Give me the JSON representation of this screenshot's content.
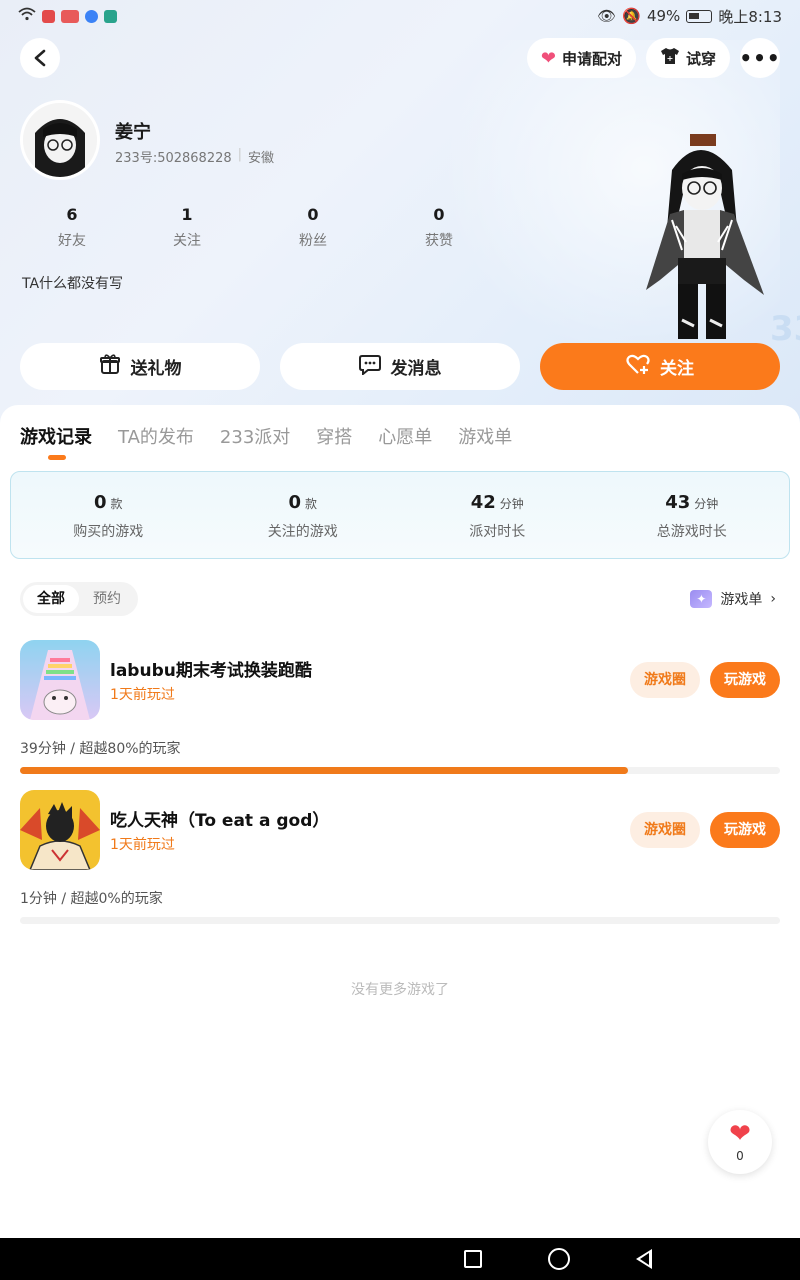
{
  "status_bar": {
    "battery": "49%",
    "time": "晚上8:13"
  },
  "top_actions": {
    "pair_label": "申请配对",
    "tryon_label": "试穿",
    "more_label": "•••"
  },
  "profile": {
    "name": "姜宁",
    "id_text": "233号:502868228",
    "location": "安徽",
    "bio": "TA什么都没有写",
    "stats": [
      {
        "value": "6",
        "label": "好友"
      },
      {
        "value": "1",
        "label": "关注"
      },
      {
        "value": "0",
        "label": "粉丝"
      },
      {
        "value": "0",
        "label": "获赞"
      }
    ]
  },
  "actions": {
    "gift": "送礼物",
    "message": "发消息",
    "follow": "关注"
  },
  "tabs": [
    "游戏记录",
    "TA的发布",
    "233派对",
    "穿搭",
    "心愿单",
    "游戏单"
  ],
  "summary": [
    {
      "value": "0",
      "unit": "款",
      "label": "购买的游戏"
    },
    {
      "value": "0",
      "unit": "款",
      "label": "关注的游戏"
    },
    {
      "value": "42",
      "unit": "分钟",
      "label": "派对时长"
    },
    {
      "value": "43",
      "unit": "分钟",
      "label": "总游戏时长"
    }
  ],
  "filter": {
    "all": "全部",
    "reserve": "预约"
  },
  "game_list_link": "游戏单",
  "games": [
    {
      "title": "labubu期末考试换装跑酷",
      "last_played": "1天前玩过",
      "circle_label": "游戏圈",
      "play_label": "玩游戏",
      "time_text": "39分钟 / 超越80%的玩家",
      "progress": 0.8
    },
    {
      "title": "吃人天神（To eat a god）",
      "last_played": "1天前玩过",
      "circle_label": "游戏圈",
      "play_label": "玩游戏",
      "time_text": "1分钟 / 超越0%的玩家",
      "progress": 0.0
    }
  ],
  "no_more": "没有更多游戏了",
  "like_count": "0",
  "colors": {
    "accent": "#fb7a1b",
    "accent_soft": "#fdeee2"
  }
}
